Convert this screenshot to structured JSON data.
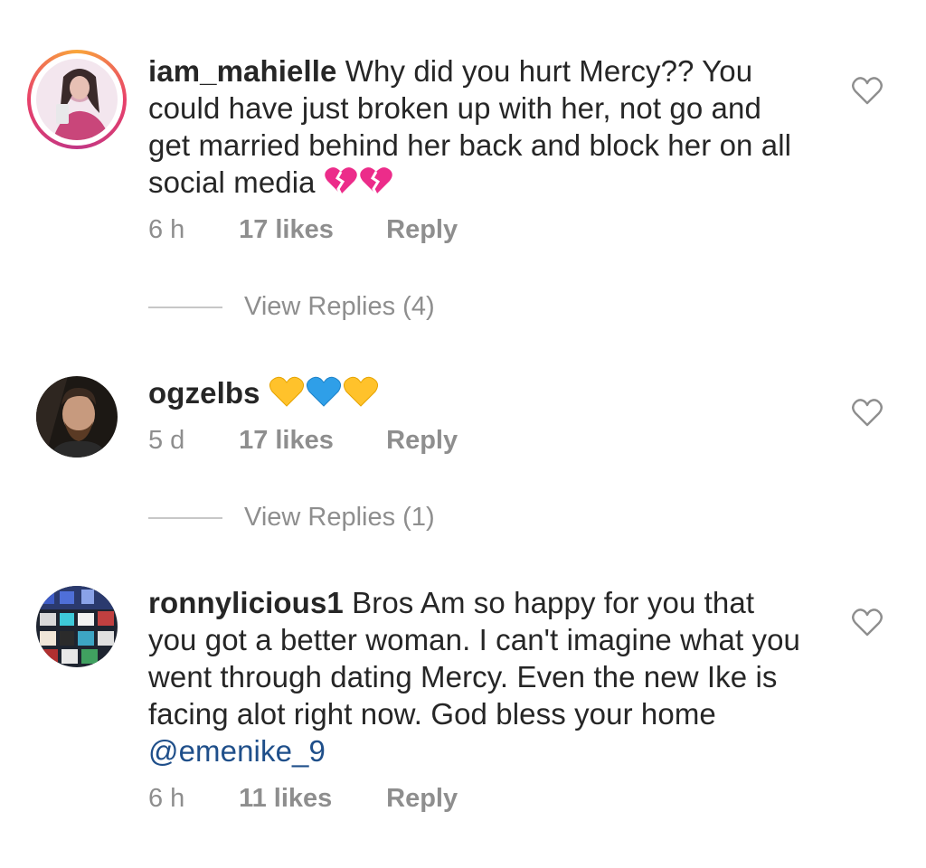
{
  "comments": [
    {
      "username": "iam_mahielle",
      "body": "Why did you hurt Mercy?? You could have just broken up with her, not go and get married behind her back and block her on all social media",
      "time": "6 h",
      "likes": "17 likes",
      "reply_label": "Reply",
      "view_replies": "View Replies (4)",
      "emoji": "broken-heart-pink x2",
      "has_story_ring": true
    },
    {
      "username": "ogzelbs",
      "body": "",
      "time": "5 d",
      "likes": "17 likes",
      "reply_label": "Reply",
      "view_replies": "View Replies (1)",
      "emoji": "yellow-heart, blue-heart, yellow-heart"
    },
    {
      "username": "ronnylicious1",
      "body": "Bros Am so happy for you that you got a better woman. I can't imagine what you went through dating Mercy. Even the new Ike is facing alot right now. God bless your home",
      "mention": "@emenike_9",
      "time": "6 h",
      "likes": "11 likes",
      "reply_label": "Reply"
    }
  ],
  "colors": {
    "text": "#262626",
    "meta": "#8e8e8e",
    "mention": "#1f4f8a",
    "divider": "#c7c7c7"
  },
  "icons": {
    "like": "heart-outline-icon"
  }
}
